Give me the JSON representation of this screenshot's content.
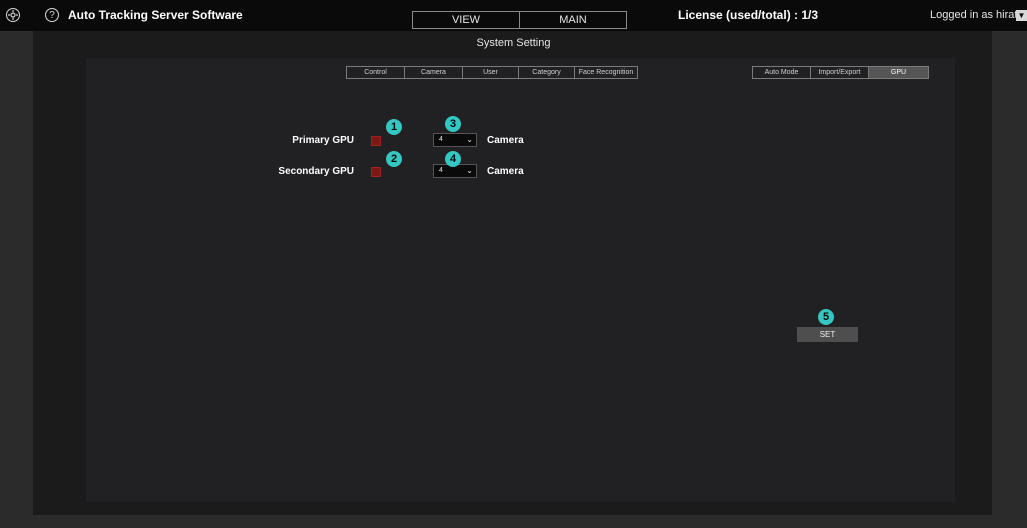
{
  "header": {
    "settings_icon": "gear-icon",
    "help_icon_glyph": "?",
    "app_title": "Auto Tracking Server Software",
    "nav_tabs": [
      {
        "label": "VIEW"
      },
      {
        "label": "MAIN"
      }
    ],
    "license": "License (used/total) : 1/3",
    "user": "Logged in as hirata",
    "user_menu_glyph": "▼"
  },
  "page": {
    "title": "System Setting"
  },
  "settings_tabs": {
    "left": [
      {
        "label": "Control"
      },
      {
        "label": "Camera"
      },
      {
        "label": "User"
      },
      {
        "label": "Category"
      },
      {
        "label": "Face Recognition"
      }
    ],
    "right": [
      {
        "label": "Auto Mode"
      },
      {
        "label": "Import/Export"
      },
      {
        "label": "GPU"
      }
    ],
    "active": "GPU"
  },
  "gpu": {
    "primary": {
      "label": "Primary GPU",
      "select_value": "4",
      "unit": "Camera"
    },
    "secondary": {
      "label": "Secondary GPU",
      "select_value": "4",
      "unit": "Camera"
    },
    "set_label": "SET"
  },
  "callouts": [
    "1",
    "2",
    "3",
    "4",
    "5"
  ],
  "colors": {
    "accent_teal": "#34c7c2",
    "checkbox_red": "#7a1818",
    "background": "#2b2b2b",
    "topbar": "#0a0a0a"
  }
}
